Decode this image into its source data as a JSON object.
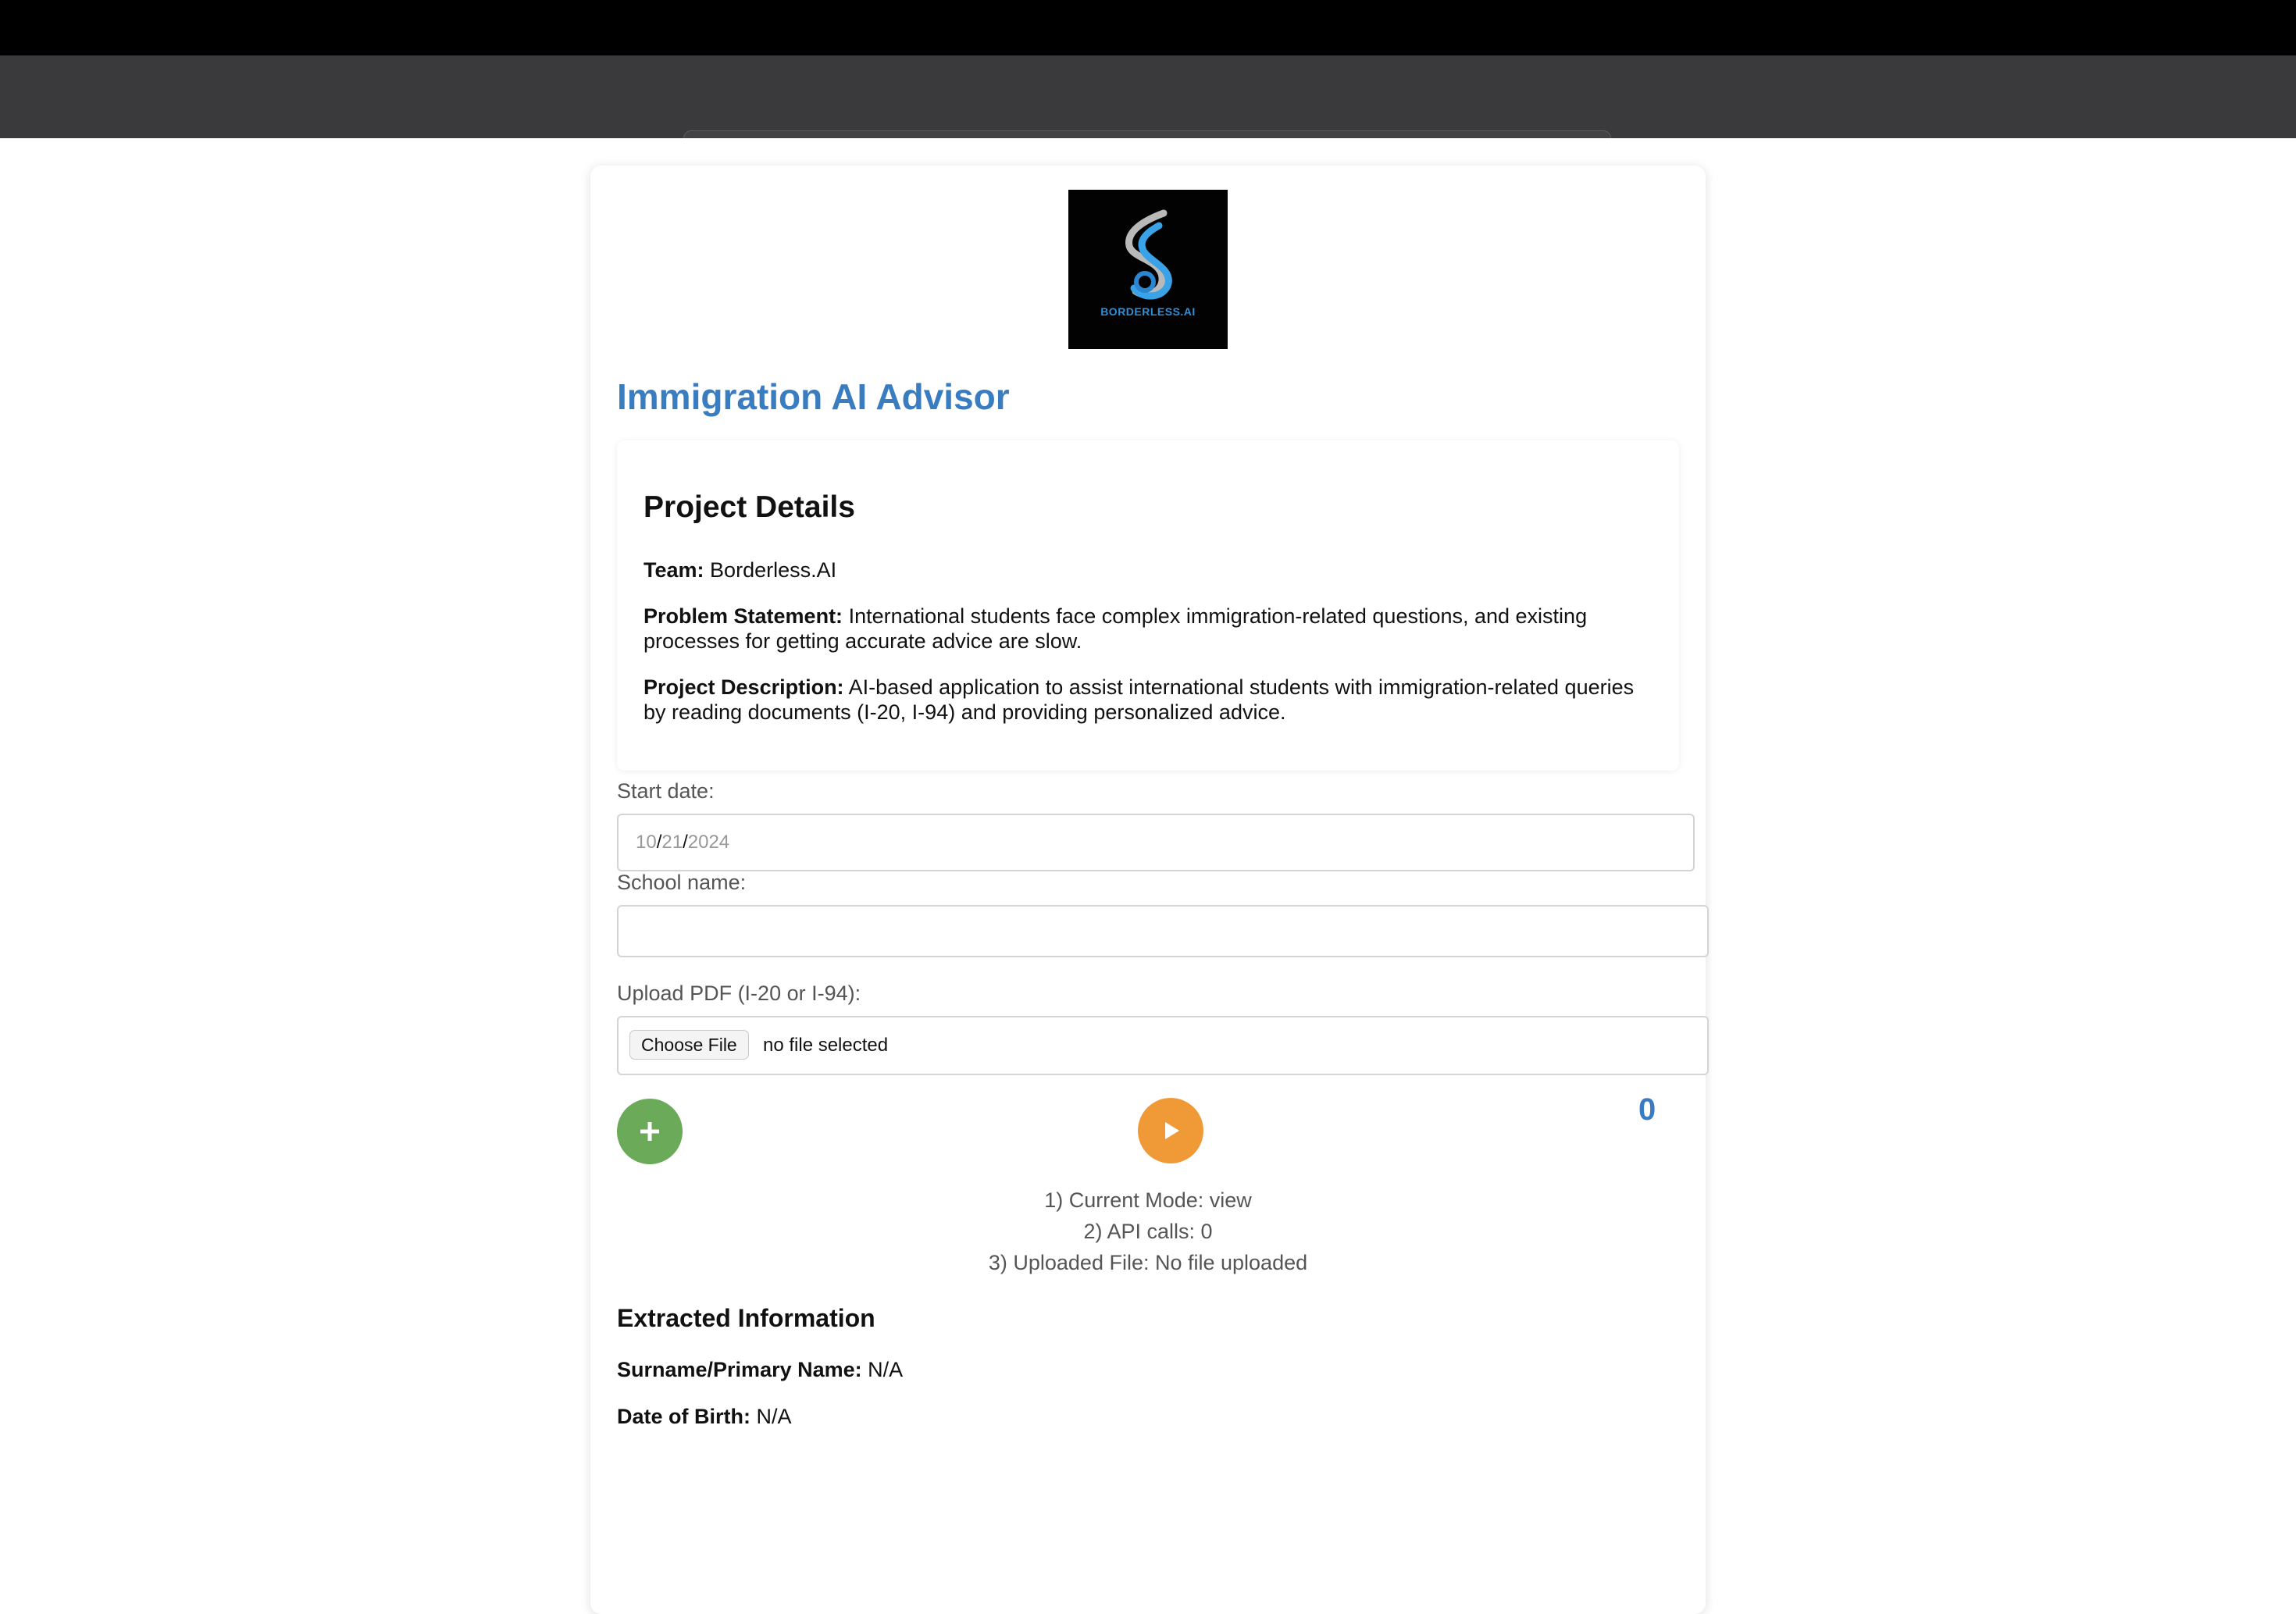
{
  "browser": {
    "url": "localhost"
  },
  "colors": {
    "title_blue": "#3a7cc0",
    "add_green": "#6aaa58",
    "play_orange": "#f09a37",
    "toolbar_gray": "#3a3a3c"
  },
  "logo": {
    "text": "BORDERLESS.AI"
  },
  "app": {
    "title": "Immigration AI Advisor"
  },
  "project": {
    "heading": "Project Details",
    "team_label": "Team:",
    "team_value": "Borderless.AI",
    "problem_label": "Problem Statement:",
    "problem_value": "International students face complex immigration-related questions, and existing processes for getting accurate advice are slow.",
    "description_label": "Project Description:",
    "description_value": "AI-based application to assist international students with immigration-related queries by reading documents (I-20, I-94) and providing personalized advice."
  },
  "form": {
    "start_date_label": "Start date:",
    "start_month": "10",
    "start_day": "21",
    "start_year": "2024",
    "date_sep": "/",
    "school_label": "School name:",
    "school_value": "",
    "upload_label": "Upload PDF (I-20 or I-94):",
    "choose_file": "Choose File",
    "no_file": "no file selected"
  },
  "controls": {
    "add_icon": "plus-icon",
    "play_icon": "play-icon",
    "counter": "0"
  },
  "status": {
    "line1": "1) Current Mode: view",
    "line2": "2) API calls: 0",
    "line3": "3) Uploaded File: No file uploaded"
  },
  "extracted": {
    "heading": "Extracted Information",
    "surname_label": "Surname/Primary Name:",
    "surname_value": "N/A",
    "dob_label": "Date of Birth:",
    "dob_value": "N/A"
  }
}
